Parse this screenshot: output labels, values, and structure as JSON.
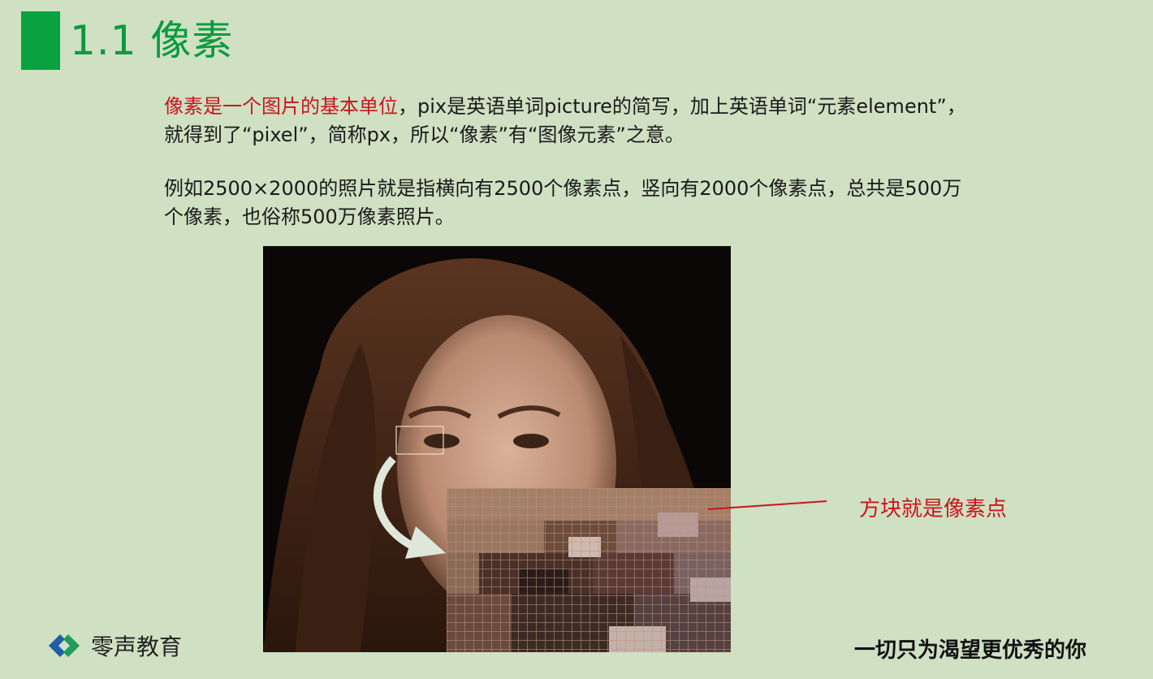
{
  "header": {
    "title": "1.1 像素"
  },
  "content": {
    "para1_red": "像素是一个图片的基本单位",
    "para1_rest_line1": "，pix是英语单词picture的简写，加上英语单词“元素element”，",
    "para1_line2": "就得到了“pixel”，简称px，所以“像素”有“图像元素”之意。",
    "para2_line1": "例如2500×2000的照片就是指横向有2500个像素点，竖向有2000个像素点，总共是500万",
    "para2_line2": "个像素，也俗称500万像素照片。"
  },
  "figure": {
    "callout": "方块就是像素点"
  },
  "footer": {
    "logo_text": "零声教育",
    "slogan": "一切只为渴望更优秀的你"
  },
  "colors": {
    "background": "#cfe0c3",
    "accent_green": "#08a340",
    "highlight_red": "#c8161d"
  }
}
